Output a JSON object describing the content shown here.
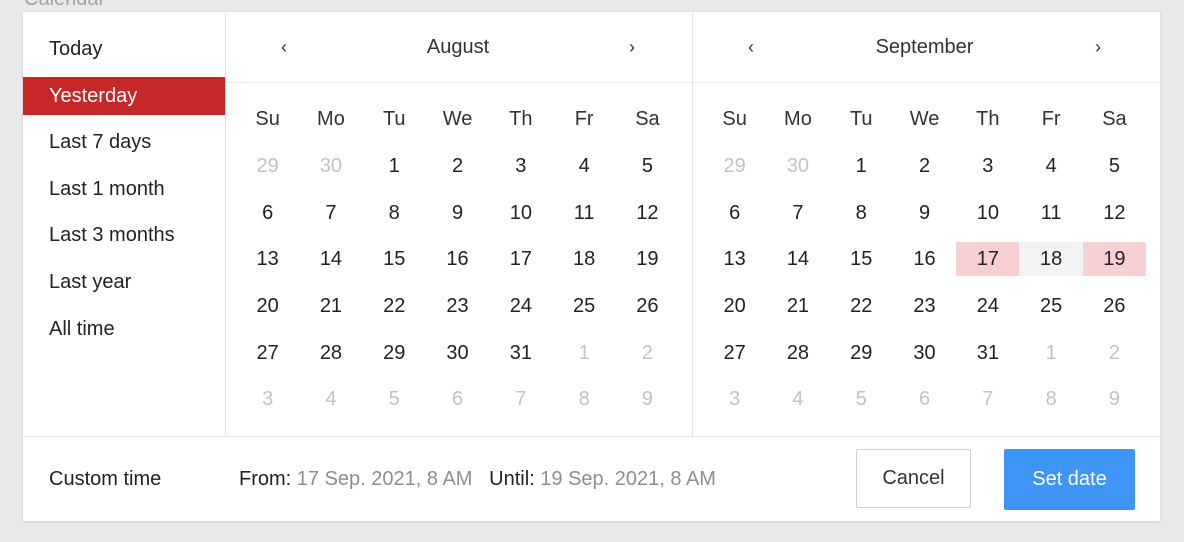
{
  "page_label": "Calendar",
  "presets": [
    {
      "label": "Today",
      "active": false
    },
    {
      "label": "Yesterday",
      "active": true
    },
    {
      "label": "Last 7 days",
      "active": false
    },
    {
      "label": "Last 1 month",
      "active": false
    },
    {
      "label": "Last 3 months",
      "active": false
    },
    {
      "label": "Last year",
      "active": false
    },
    {
      "label": "All time",
      "active": false
    }
  ],
  "calendars": [
    {
      "month": "August",
      "prev": "‹",
      "next": "›",
      "weekdays": [
        "Su",
        "Mo",
        "Tu",
        "We",
        "Th",
        "Fr",
        "Sa"
      ],
      "days": [
        [
          "29",
          "30",
          "1",
          "2",
          "3",
          "4",
          "5"
        ],
        [
          "6",
          "7",
          "8",
          "9",
          "10",
          "11",
          "12"
        ],
        [
          "13",
          "14",
          "15",
          "16",
          "17",
          "18",
          "19"
        ],
        [
          "20",
          "21",
          "22",
          "23",
          "24",
          "25",
          "26"
        ],
        [
          "27",
          "28",
          "29",
          "30",
          "31",
          "1",
          "2"
        ],
        [
          "3",
          "4",
          "5",
          "6",
          "7",
          "8",
          "9"
        ]
      ],
      "outside_month": [
        [
          0,
          0
        ],
        [
          0,
          1
        ],
        [
          4,
          5
        ],
        [
          4,
          6
        ],
        [
          5,
          0
        ],
        [
          5,
          1
        ],
        [
          5,
          2
        ],
        [
          5,
          3
        ],
        [
          5,
          4
        ],
        [
          5,
          5
        ],
        [
          5,
          6
        ]
      ],
      "range_endpoints": [],
      "range_middle": []
    },
    {
      "month": "September",
      "prev": "‹",
      "next": "›",
      "weekdays": [
        "Su",
        "Mo",
        "Tu",
        "We",
        "Th",
        "Fr",
        "Sa"
      ],
      "days": [
        [
          "29",
          "30",
          "1",
          "2",
          "3",
          "4",
          "5"
        ],
        [
          "6",
          "7",
          "8",
          "9",
          "10",
          "11",
          "12"
        ],
        [
          "13",
          "14",
          "15",
          "16",
          "17",
          "18",
          "19"
        ],
        [
          "20",
          "21",
          "22",
          "23",
          "24",
          "25",
          "26"
        ],
        [
          "27",
          "28",
          "29",
          "30",
          "31",
          "1",
          "2"
        ],
        [
          "3",
          "4",
          "5",
          "6",
          "7",
          "8",
          "9"
        ]
      ],
      "outside_month": [
        [
          0,
          0
        ],
        [
          0,
          1
        ],
        [
          4,
          5
        ],
        [
          4,
          6
        ],
        [
          5,
          0
        ],
        [
          5,
          1
        ],
        [
          5,
          2
        ],
        [
          5,
          3
        ],
        [
          5,
          4
        ],
        [
          5,
          5
        ],
        [
          5,
          6
        ]
      ],
      "range_endpoints": [
        [
          2,
          4
        ],
        [
          2,
          6
        ]
      ],
      "range_middle": [
        [
          2,
          5
        ]
      ]
    }
  ],
  "footer": {
    "custom_label": "Custom time",
    "from_key": "From:",
    "from_value": "17 Sep. 2021, 8 AM",
    "until_key": "Until:",
    "until_value": "19 Sep. 2021, 8 AM",
    "cancel_label": "Cancel",
    "set_label": "Set date"
  },
  "colors": {
    "active_preset": "#c62828",
    "range_endpoint": "#f7d0d4",
    "range_middle": "#f2f2f2",
    "primary_button": "#3f95f5"
  }
}
